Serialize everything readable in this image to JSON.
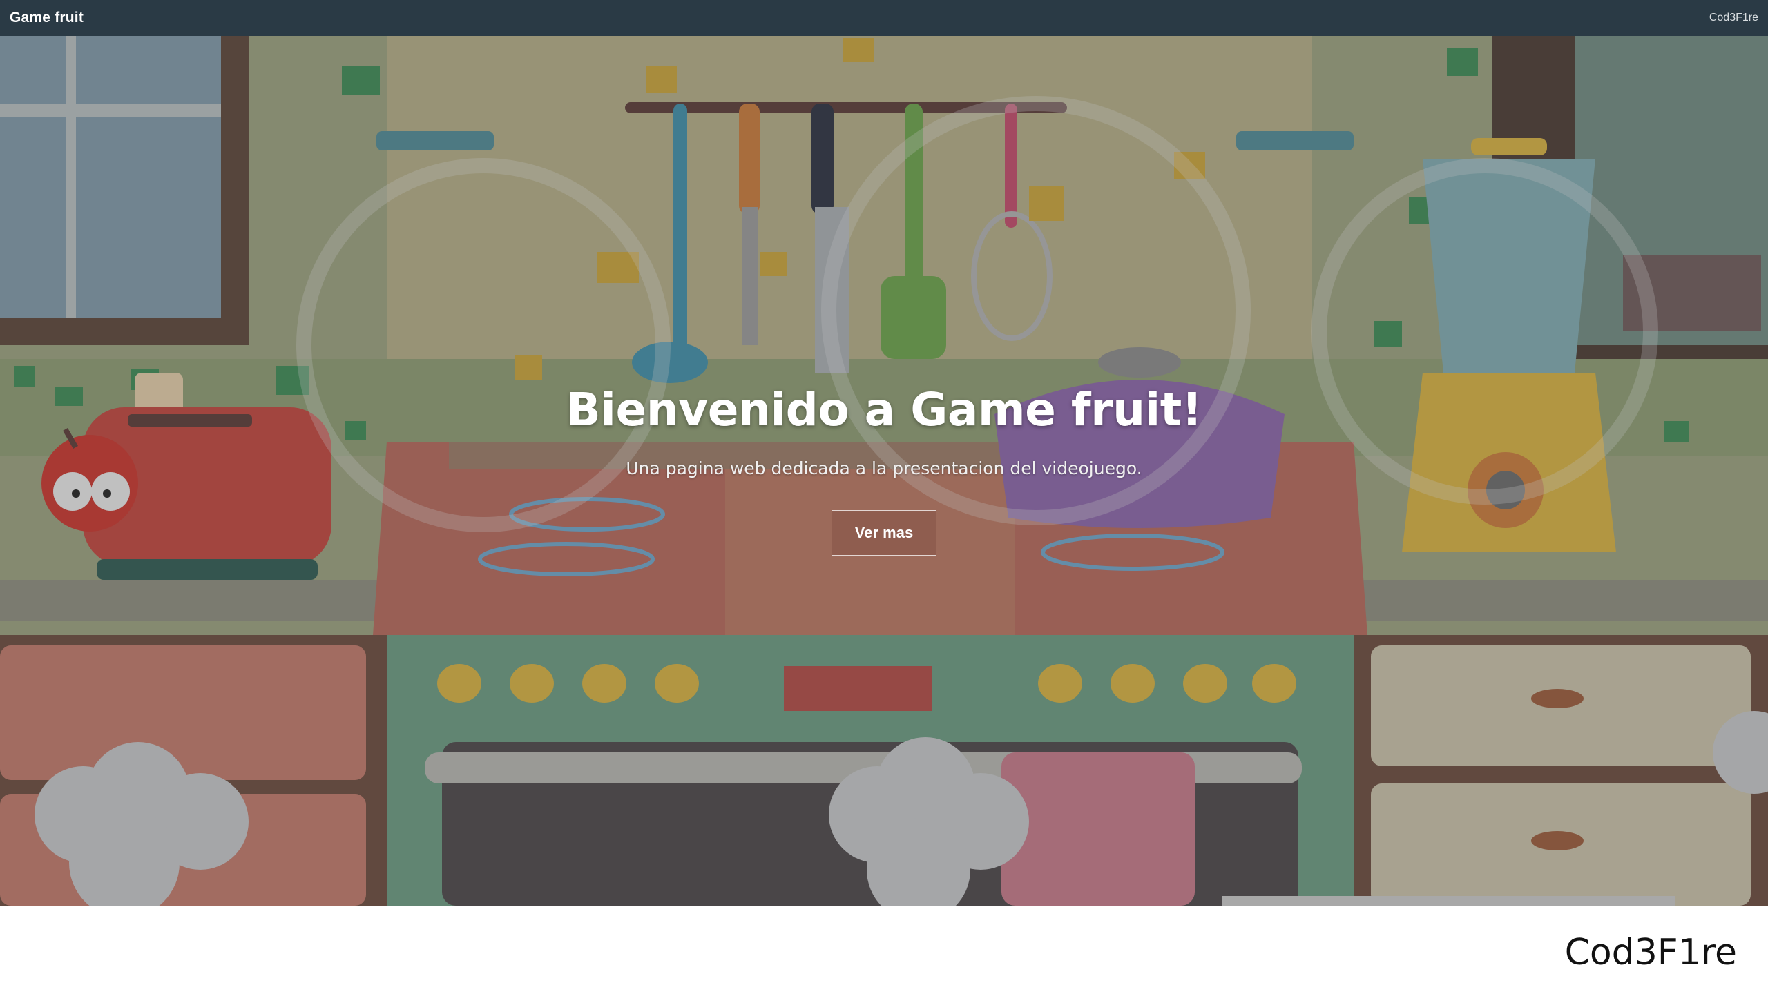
{
  "navbar": {
    "brand": "Game fruit",
    "author": "Cod3F1re"
  },
  "hero": {
    "title": "Bienvenido a Game fruit!",
    "subtitle": "Una pagina web dedicada a la presentacion del videojuego.",
    "button_label": "Ver mas"
  },
  "footer": {
    "author": "Cod3F1re"
  },
  "colors": {
    "navbar": "#2a3a45",
    "wall": "#b9b28a",
    "counter": "#b36a55",
    "stove": "#6a9a80",
    "cabinet": "#b97a6a"
  },
  "icons": [
    "apple-character-icon",
    "toaster-icon",
    "blender-icon",
    "pot-icon",
    "utensil-rack-icon"
  ]
}
